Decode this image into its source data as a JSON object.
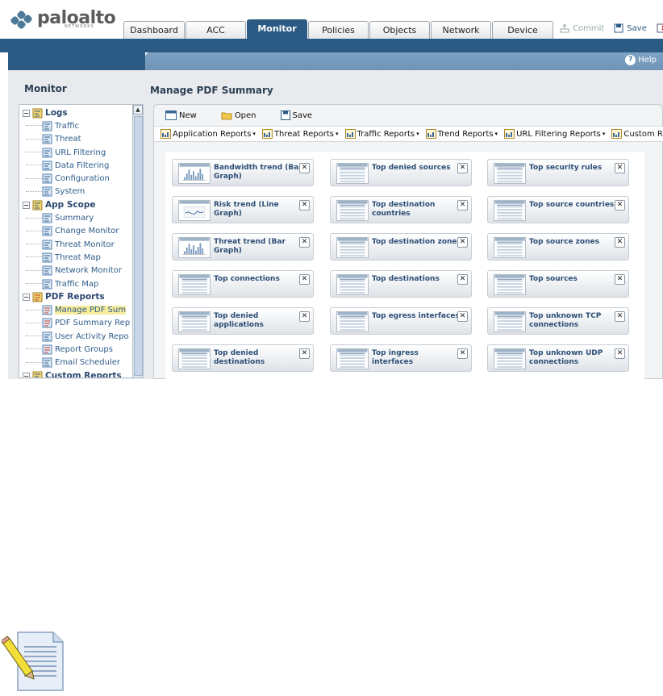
{
  "brand": {
    "name": "paloalto",
    "sub": "NETWORKS"
  },
  "tabs": [
    {
      "label": "Dashboard",
      "active": false
    },
    {
      "label": "ACC",
      "active": false
    },
    {
      "label": "Monitor",
      "active": true
    },
    {
      "label": "Policies",
      "active": false
    },
    {
      "label": "Objects",
      "active": false
    },
    {
      "label": "Network",
      "active": false
    },
    {
      "label": "Device",
      "active": false
    }
  ],
  "header_actions": {
    "commit": "Commit",
    "save": "Save"
  },
  "help": "Help",
  "left_panel": {
    "title": "Monitor",
    "tree": [
      {
        "label": "Logs",
        "type": "group",
        "icon": "logs-icon"
      },
      {
        "label": "Traffic",
        "type": "item",
        "icon": "traffic-log-icon"
      },
      {
        "label": "Threat",
        "type": "item",
        "icon": "threat-log-icon"
      },
      {
        "label": "URL Filtering",
        "type": "item",
        "icon": "url-filtering-icon"
      },
      {
        "label": "Data Filtering",
        "type": "item",
        "icon": "data-filtering-icon"
      },
      {
        "label": "Configuration",
        "type": "item",
        "icon": "configuration-icon"
      },
      {
        "label": "System",
        "type": "item",
        "icon": "system-icon"
      },
      {
        "label": "App Scope",
        "type": "group",
        "icon": "app-scope-icon"
      },
      {
        "label": "Summary",
        "type": "item",
        "icon": "summary-icon"
      },
      {
        "label": "Change Monitor",
        "type": "item",
        "icon": "change-monitor-icon"
      },
      {
        "label": "Threat Monitor",
        "type": "item",
        "icon": "threat-monitor-icon"
      },
      {
        "label": "Threat Map",
        "type": "item",
        "icon": "threat-map-icon"
      },
      {
        "label": "Network Monitor",
        "type": "item",
        "icon": "network-monitor-icon"
      },
      {
        "label": "Traffic Map",
        "type": "item",
        "icon": "traffic-map-icon"
      },
      {
        "label": "PDF Reports",
        "type": "group",
        "icon": "pdf-reports-icon"
      },
      {
        "label": "Manage PDF Sum",
        "type": "item",
        "icon": "pdf-icon",
        "selected": true
      },
      {
        "label": "PDF Summary Rep",
        "type": "item",
        "icon": "pdf-icon"
      },
      {
        "label": "User Activity Repo",
        "type": "item",
        "icon": "user-activity-icon"
      },
      {
        "label": "Report Groups",
        "type": "item",
        "icon": "pdf-icon"
      },
      {
        "label": "Email Scheduler",
        "type": "item",
        "icon": "email-icon"
      },
      {
        "label": "Custom Reports",
        "type": "group",
        "icon": "custom-reports-icon"
      }
    ]
  },
  "main": {
    "title": "Manage PDF Summary",
    "actions": {
      "new": "New",
      "open": "Open",
      "save": "Save"
    },
    "menus": [
      "Application Reports",
      "Threat Reports",
      "Traffic Reports",
      "Trend Reports",
      "URL Filtering Reports",
      "Custom Reports"
    ],
    "cards": [
      {
        "title": "Bandwidth trend (Bar Graph)",
        "thumb": "bar"
      },
      {
        "title": "Top denied sources",
        "thumb": "table"
      },
      {
        "title": "Top security rules",
        "thumb": "table"
      },
      {
        "title": "Risk trend (Line Graph)",
        "thumb": "line"
      },
      {
        "title": "Top destination countries",
        "thumb": "table"
      },
      {
        "title": "Top source countries",
        "thumb": "table"
      },
      {
        "title": "Threat trend (Bar Graph)",
        "thumb": "bar"
      },
      {
        "title": "Top destination zones",
        "thumb": "table"
      },
      {
        "title": "Top source zones",
        "thumb": "table"
      },
      {
        "title": "Top connections",
        "thumb": "table"
      },
      {
        "title": "Top destinations",
        "thumb": "table"
      },
      {
        "title": "Top sources",
        "thumb": "table"
      },
      {
        "title": "Top denied applications",
        "thumb": "table"
      },
      {
        "title": "Top egress interfaces",
        "thumb": "table"
      },
      {
        "title": "Top unknown TCP connections",
        "thumb": "table"
      },
      {
        "title": "Top denied destinations",
        "thumb": "table"
      },
      {
        "title": "Top ingress interfaces",
        "thumb": "table"
      },
      {
        "title": "Top unknown UDP connections",
        "thumb": "table"
      }
    ]
  },
  "colors": {
    "nav_blue": "#2b5b84",
    "sub_bar": "#7fa3c4",
    "card_title": "#2c4e75",
    "selection": "#f6ec9c"
  }
}
